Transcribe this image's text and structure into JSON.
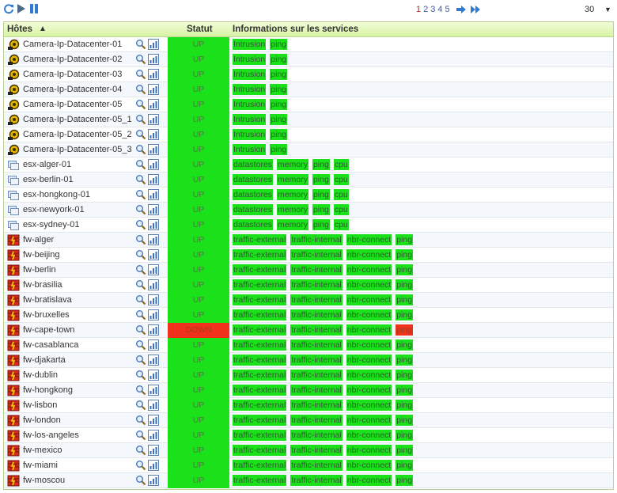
{
  "toolbar": {
    "pages": [
      "1",
      "2",
      "3",
      "4",
      "5"
    ],
    "active_page": "1",
    "per_page": "30"
  },
  "table": {
    "col_hosts": "Hôtes",
    "col_status": "Statut",
    "col_services": "Informations sur les services",
    "rows": [
      {
        "name": "Camera-Ip-Datacenter-01",
        "icon": "camera-icon",
        "status": "UP",
        "services": [
          {
            "label": "Intrusion",
            "state": "ok"
          },
          {
            "label": "ping",
            "state": "ok"
          }
        ]
      },
      {
        "name": "Camera-Ip-Datacenter-02",
        "icon": "camera-icon",
        "status": "UP",
        "services": [
          {
            "label": "Intrusion",
            "state": "ok"
          },
          {
            "label": "ping",
            "state": "ok"
          }
        ]
      },
      {
        "name": "Camera-Ip-Datacenter-03",
        "icon": "camera-icon",
        "status": "UP",
        "services": [
          {
            "label": "Intrusion",
            "state": "ok"
          },
          {
            "label": "ping",
            "state": "ok"
          }
        ]
      },
      {
        "name": "Camera-Ip-Datacenter-04",
        "icon": "camera-icon",
        "status": "UP",
        "services": [
          {
            "label": "Intrusion",
            "state": "ok"
          },
          {
            "label": "ping",
            "state": "ok"
          }
        ]
      },
      {
        "name": "Camera-Ip-Datacenter-05",
        "icon": "camera-icon",
        "status": "UP",
        "services": [
          {
            "label": "Intrusion",
            "state": "ok"
          },
          {
            "label": "ping",
            "state": "ok"
          }
        ]
      },
      {
        "name": "Camera-Ip-Datacenter-05_1",
        "icon": "camera-icon",
        "status": "UP",
        "services": [
          {
            "label": "Intrusion",
            "state": "ok"
          },
          {
            "label": "ping",
            "state": "ok"
          }
        ]
      },
      {
        "name": "Camera-Ip-Datacenter-05_2",
        "icon": "camera-icon",
        "status": "UP",
        "services": [
          {
            "label": "Intrusion",
            "state": "ok"
          },
          {
            "label": "ping",
            "state": "ok"
          }
        ]
      },
      {
        "name": "Camera-Ip-Datacenter-05_3",
        "icon": "camera-icon",
        "status": "UP",
        "services": [
          {
            "label": "Intrusion",
            "state": "ok"
          },
          {
            "label": "ping",
            "state": "ok"
          }
        ]
      },
      {
        "name": "esx-alger-01",
        "icon": "server-icon",
        "status": "UP",
        "services": [
          {
            "label": "datastores",
            "state": "ok"
          },
          {
            "label": "memory",
            "state": "ok"
          },
          {
            "label": "ping",
            "state": "ok"
          },
          {
            "label": "cpu",
            "state": "ok"
          }
        ]
      },
      {
        "name": "esx-berlin-01",
        "icon": "server-icon",
        "status": "UP",
        "services": [
          {
            "label": "datastores",
            "state": "ok"
          },
          {
            "label": "memory",
            "state": "ok"
          },
          {
            "label": "ping",
            "state": "ok"
          },
          {
            "label": "cpu",
            "state": "ok"
          }
        ]
      },
      {
        "name": "esx-hongkong-01",
        "icon": "server-icon",
        "status": "UP",
        "services": [
          {
            "label": "datastores",
            "state": "ok"
          },
          {
            "label": "memory",
            "state": "ok"
          },
          {
            "label": "ping",
            "state": "ok"
          },
          {
            "label": "cpu",
            "state": "ok"
          }
        ]
      },
      {
        "name": "esx-newyork-01",
        "icon": "server-icon",
        "status": "UP",
        "services": [
          {
            "label": "datastores",
            "state": "ok"
          },
          {
            "label": "memory",
            "state": "ok"
          },
          {
            "label": "ping",
            "state": "ok"
          },
          {
            "label": "cpu",
            "state": "ok"
          }
        ]
      },
      {
        "name": "esx-sydney-01",
        "icon": "server-icon",
        "status": "UP",
        "services": [
          {
            "label": "datastores",
            "state": "ok"
          },
          {
            "label": "memory",
            "state": "ok"
          },
          {
            "label": "ping",
            "state": "ok"
          },
          {
            "label": "cpu",
            "state": "ok"
          }
        ]
      },
      {
        "name": "fw-alger",
        "icon": "firewall-icon",
        "status": "UP",
        "services": [
          {
            "label": "traffic-external",
            "state": "ok"
          },
          {
            "label": "traffic-internal",
            "state": "ok"
          },
          {
            "label": "nbr-connect",
            "state": "ok"
          },
          {
            "label": "ping",
            "state": "ok"
          }
        ]
      },
      {
        "name": "fw-beijing",
        "icon": "firewall-icon",
        "status": "UP",
        "services": [
          {
            "label": "traffic-external",
            "state": "ok"
          },
          {
            "label": "traffic-internal",
            "state": "ok"
          },
          {
            "label": "nbr-connect",
            "state": "ok"
          },
          {
            "label": "ping",
            "state": "ok"
          }
        ]
      },
      {
        "name": "fw-berlin",
        "icon": "firewall-icon",
        "status": "UP",
        "services": [
          {
            "label": "traffic-external",
            "state": "ok"
          },
          {
            "label": "traffic-internal",
            "state": "ok"
          },
          {
            "label": "nbr-connect",
            "state": "ok"
          },
          {
            "label": "ping",
            "state": "ok"
          }
        ]
      },
      {
        "name": "fw-brasilia",
        "icon": "firewall-icon",
        "status": "UP",
        "services": [
          {
            "label": "traffic-external",
            "state": "ok"
          },
          {
            "label": "traffic-internal",
            "state": "ok"
          },
          {
            "label": "nbr-connect",
            "state": "ok"
          },
          {
            "label": "ping",
            "state": "ok"
          }
        ]
      },
      {
        "name": "fw-bratislava",
        "icon": "firewall-icon",
        "status": "UP",
        "services": [
          {
            "label": "traffic-external",
            "state": "ok"
          },
          {
            "label": "traffic-internal",
            "state": "ok"
          },
          {
            "label": "nbr-connect",
            "state": "ok"
          },
          {
            "label": "ping",
            "state": "ok"
          }
        ]
      },
      {
        "name": "fw-bruxelles",
        "icon": "firewall-icon",
        "status": "UP",
        "services": [
          {
            "label": "traffic-external",
            "state": "ok"
          },
          {
            "label": "traffic-internal",
            "state": "ok"
          },
          {
            "label": "nbr-connect",
            "state": "ok"
          },
          {
            "label": "ping",
            "state": "ok"
          }
        ]
      },
      {
        "name": "fw-cape-town",
        "icon": "firewall-icon",
        "status": "DOWN",
        "services": [
          {
            "label": "traffic-external",
            "state": "ok"
          },
          {
            "label": "traffic-internal",
            "state": "ok"
          },
          {
            "label": "nbr-connect",
            "state": "ok"
          },
          {
            "label": "ping",
            "state": "critical"
          }
        ]
      },
      {
        "name": "fw-casablanca",
        "icon": "firewall-icon",
        "status": "UP",
        "services": [
          {
            "label": "traffic-external",
            "state": "ok"
          },
          {
            "label": "traffic-internal",
            "state": "ok"
          },
          {
            "label": "nbr-connect",
            "state": "ok"
          },
          {
            "label": "ping",
            "state": "ok"
          }
        ]
      },
      {
        "name": "fw-djakarta",
        "icon": "firewall-icon",
        "status": "UP",
        "services": [
          {
            "label": "traffic-external",
            "state": "ok"
          },
          {
            "label": "traffic-internal",
            "state": "ok"
          },
          {
            "label": "nbr-connect",
            "state": "ok"
          },
          {
            "label": "ping",
            "state": "ok"
          }
        ]
      },
      {
        "name": "fw-dublin",
        "icon": "firewall-icon",
        "status": "UP",
        "services": [
          {
            "label": "traffic-external",
            "state": "ok"
          },
          {
            "label": "traffic-internal",
            "state": "ok"
          },
          {
            "label": "nbr-connect",
            "state": "ok"
          },
          {
            "label": "ping",
            "state": "ok"
          }
        ]
      },
      {
        "name": "fw-hongkong",
        "icon": "firewall-icon",
        "status": "UP",
        "services": [
          {
            "label": "traffic-external",
            "state": "ok"
          },
          {
            "label": "traffic-internal",
            "state": "ok"
          },
          {
            "label": "nbr-connect",
            "state": "ok"
          },
          {
            "label": "ping",
            "state": "ok"
          }
        ]
      },
      {
        "name": "fw-lisbon",
        "icon": "firewall-icon",
        "status": "UP",
        "services": [
          {
            "label": "traffic-external",
            "state": "ok"
          },
          {
            "label": "traffic-internal",
            "state": "ok"
          },
          {
            "label": "nbr-connect",
            "state": "ok"
          },
          {
            "label": "ping",
            "state": "ok"
          }
        ]
      },
      {
        "name": "fw-london",
        "icon": "firewall-icon",
        "status": "UP",
        "services": [
          {
            "label": "traffic-external",
            "state": "ok"
          },
          {
            "label": "traffic-internal",
            "state": "ok"
          },
          {
            "label": "nbr-connect",
            "state": "ok"
          },
          {
            "label": "ping",
            "state": "ok"
          }
        ]
      },
      {
        "name": "fw-los-angeles",
        "icon": "firewall-icon",
        "status": "UP",
        "services": [
          {
            "label": "traffic-external",
            "state": "ok"
          },
          {
            "label": "traffic-internal",
            "state": "ok"
          },
          {
            "label": "nbr-connect",
            "state": "ok"
          },
          {
            "label": "ping",
            "state": "ok"
          }
        ]
      },
      {
        "name": "fw-mexico",
        "icon": "firewall-icon",
        "status": "UP",
        "services": [
          {
            "label": "traffic-external",
            "state": "ok"
          },
          {
            "label": "traffic-internal",
            "state": "ok"
          },
          {
            "label": "nbr-connect",
            "state": "ok"
          },
          {
            "label": "ping",
            "state": "ok"
          }
        ]
      },
      {
        "name": "fw-miami",
        "icon": "firewall-icon",
        "status": "UP",
        "services": [
          {
            "label": "traffic-external",
            "state": "ok"
          },
          {
            "label": "traffic-internal",
            "state": "ok"
          },
          {
            "label": "nbr-connect",
            "state": "ok"
          },
          {
            "label": "ping",
            "state": "ok"
          }
        ]
      },
      {
        "name": "fw-moscou",
        "icon": "firewall-icon",
        "status": "UP",
        "services": [
          {
            "label": "traffic-external",
            "state": "ok"
          },
          {
            "label": "traffic-internal",
            "state": "ok"
          },
          {
            "label": "nbr-connect",
            "state": "ok"
          },
          {
            "label": "ping",
            "state": "ok"
          }
        ]
      }
    ]
  },
  "colors": {
    "up": "#1be11b",
    "down": "#f0321d",
    "header_bg": "#d6f3a2",
    "link": "#3b5ca8",
    "active_page": "#d0201a"
  }
}
